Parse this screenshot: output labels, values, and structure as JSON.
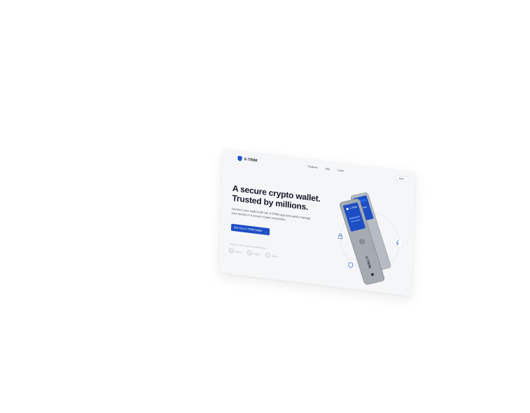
{
  "nav": {
    "brand": "X-TRIM",
    "links": [
      "Products",
      "App",
      "Learn"
    ],
    "cta": "Cart"
  },
  "hero": {
    "title_line1": "A secure crypto wallet.",
    "title_line2": "Trusted by millions.",
    "subtitle": "Connect your wallet with the X-TRIM app and easily manage your assets in a secure crypto ecosystem.",
    "cta_label": "Get Your X-TRIM Wallet",
    "cta_arrow": "→",
    "trusted_text": "Trusted by 1,000+ businesses and individuals",
    "partners": [
      "Partner",
      "Ledger",
      "Partner"
    ]
  },
  "device": {
    "brand_text": "X-TRIM"
  },
  "colors": {
    "accent": "#1d4fc4",
    "card_bg": "#f5f6f8",
    "device_body": "#9aa0a8"
  }
}
